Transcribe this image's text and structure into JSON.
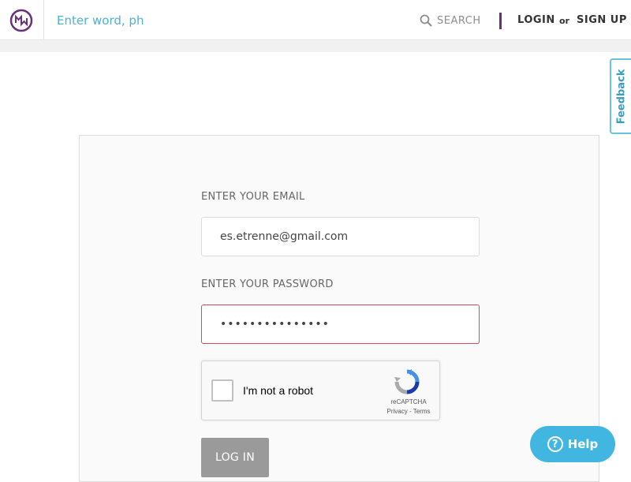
{
  "header": {
    "search_placeholder": "Enter word, ph",
    "search_label": "SEARCH",
    "login_label": "LOGIN",
    "or_text": "or",
    "signup_label": "SIGN UP"
  },
  "feedback": {
    "label": "Feedback"
  },
  "form": {
    "email_label": "ENTER YOUR EMAIL",
    "email_value": "es.etrenne@gmail.com",
    "password_label": "ENTER YOUR PASSWORD",
    "password_value": "•••••••••••••••",
    "captcha": {
      "label": "I'm not a robot",
      "brand": "reCAPTCHA",
      "links": "Privacy - Terms"
    },
    "login_button": "LOG IN"
  },
  "help": {
    "label": "Help",
    "icon_glyph": "?"
  },
  "colors": {
    "accent_purple": "#6b2f7e",
    "search_blue": "#4fb0cf",
    "error_red": "#d8485a",
    "help_blue": "#41b6e0"
  }
}
